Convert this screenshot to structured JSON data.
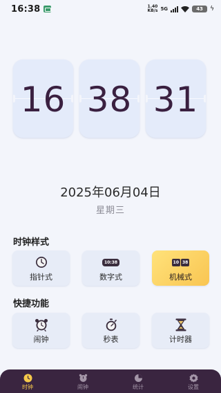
{
  "status_bar": {
    "time": "16:38",
    "net_speed_value": "1.40",
    "net_speed_unit": "KB/s",
    "signal_label": "5G",
    "battery": "43"
  },
  "clock": {
    "hours": "16",
    "minutes": "38",
    "seconds": "31"
  },
  "date": "2025年06月04日",
  "weekday": "星期三",
  "clock_style": {
    "title": "时钟样式",
    "options": [
      {
        "label": "指针式",
        "icon": "analog-clock-icon",
        "selected": false
      },
      {
        "label": "数字式",
        "icon": "digital-clock-icon",
        "chip": "10:38",
        "selected": false
      },
      {
        "label": "机械式",
        "icon": "flip-clock-icon",
        "chip_a": "10",
        "chip_b": "38",
        "selected": true
      }
    ]
  },
  "quick_functions": {
    "title": "快捷功能",
    "items": [
      {
        "label": "闹钟",
        "icon": "alarm-clock-icon"
      },
      {
        "label": "秒表",
        "icon": "stopwatch-icon"
      },
      {
        "label": "计时器",
        "icon": "hourglass-icon"
      }
    ]
  },
  "bottom_nav": {
    "items": [
      {
        "label": "时钟",
        "icon": "clock-icon",
        "active": true
      },
      {
        "label": "闹钟",
        "icon": "alarm-icon",
        "active": false
      },
      {
        "label": "统计",
        "icon": "pie-chart-icon",
        "active": false
      },
      {
        "label": "设置",
        "icon": "gear-icon",
        "active": false
      }
    ]
  },
  "colors": {
    "background": "#f3f5fb",
    "card": "#e4ebfa",
    "digit": "#3a2040",
    "accent": "#f9c552",
    "nav_bg": "#3a2540"
  }
}
